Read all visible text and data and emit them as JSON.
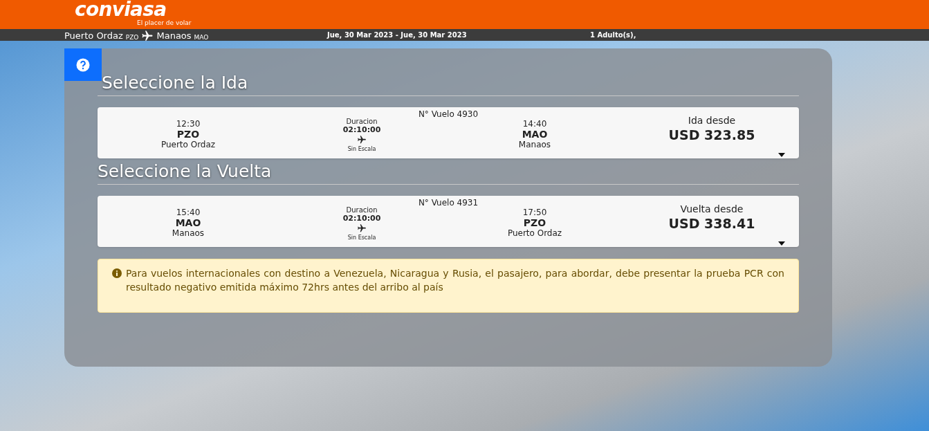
{
  "header": {
    "logo": "conviasa",
    "tagline": "El placer de volar"
  },
  "summary": {
    "origin": "Puerto Ordaz",
    "origin_code": "PZO",
    "destination": "Manaos",
    "destination_code": "MAO",
    "dates": "Jue, 30 Mar 2023 - Jue, 30 Mar 2023",
    "passengers": "1 Adulto(s),"
  },
  "sections": [
    {
      "title": "Seleccione la Ida",
      "flight": {
        "number": "N° Vuelo 4930",
        "dep_time": "12:30",
        "dep_code": "PZO",
        "dep_city": "Puerto Ordaz",
        "duration_label": "Duracion",
        "duration": "02:10:00",
        "stops": "Sin Escala",
        "arr_time": "14:40",
        "arr_code": "MAO",
        "arr_city": "Manaos",
        "price_label": "Ida desde",
        "price": "USD 323.85"
      }
    },
    {
      "title": "Seleccione la Vuelta",
      "flight": {
        "number": "N° Vuelo 4931",
        "dep_time": "15:40",
        "dep_code": "MAO",
        "dep_city": "Manaos",
        "duration_label": "Duracion",
        "duration": "02:10:00",
        "stops": "Sin Escala",
        "arr_time": "17:50",
        "arr_code": "PZO",
        "arr_city": "Puerto Ordaz",
        "price_label": "Vuelta desde",
        "price": "USD 338.41"
      }
    }
  ],
  "notice": "Para vuelos internacionales con destino a Venezuela, Nicaragua y Rusia, el pasajero, para abordar, debe presentar la prueba PCR con resultado negativo emitida máximo 72hrs antes del arribo al país"
}
